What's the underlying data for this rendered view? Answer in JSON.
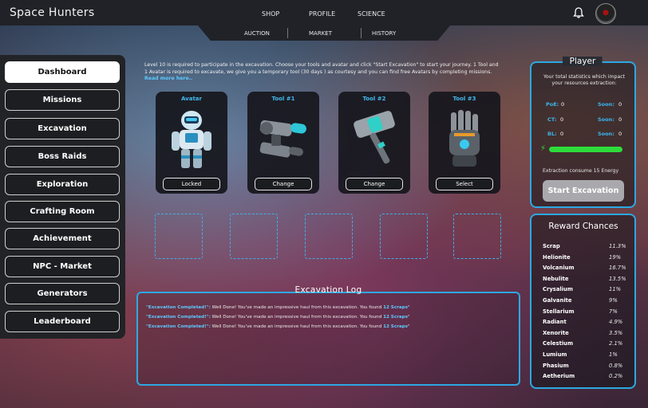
{
  "brand": "Space Hunters",
  "top_nav": [
    "SHOP",
    "PROFILE",
    "SCIENCE"
  ],
  "sub_nav": [
    "AUCTION",
    "MARKET",
    "HISTORY"
  ],
  "sidebar": [
    "Dashboard",
    "Missions",
    "Excavation",
    "Boss Raids",
    "Exploration",
    "Crafting Room",
    "Achievement",
    "NPC - Market",
    "Generators",
    "Leaderboard"
  ],
  "intro": {
    "text": "Level 10 is required to participate in the excavation. Choose your tools and avatar and click \"Start Excavation\" to start your journey. 1 Tool and 1 Avatar is required to excavate, we give you a temporary tool (30 days ) as courtesy and  you can  find free Avatars by completing missions. ",
    "more": "Read more here.."
  },
  "cards": [
    {
      "title": "Avatar",
      "button": "Locked",
      "icon": "robot-avatar-icon"
    },
    {
      "title": "Tool #1",
      "button": "Change",
      "icon": "plasma-drill-icon"
    },
    {
      "title": "Tool #2",
      "button": "Change",
      "icon": "hammer-icon"
    },
    {
      "title": "Tool #3",
      "button": "Select",
      "icon": "power-glove-icon"
    }
  ],
  "log": {
    "title": "Excavation Log",
    "entries": [
      {
        "status": "\"Excavation Completed!\":",
        "msg": " Well Done! You've made an impressive haul from this excavation. You found ",
        "found": "12 Scraps",
        "end": "\""
      },
      {
        "status": "\"Excavation Completed!\":",
        "msg": " Well Done! You've made an impressive haul from this excavation. You found ",
        "found": "12 Scraps",
        "end": "\""
      },
      {
        "status": "\"Excavation Completed!\":",
        "msg": " Well Done! You've made an impressive haul from this excavation. You found ",
        "found": "12 Scraps",
        "end": "\""
      }
    ]
  },
  "player": {
    "title": "Player",
    "desc": "Your total statistics which impact your resources extraction:",
    "stats": [
      {
        "label": "PoE:",
        "value": "0",
        "soon_label": "Soon:",
        "soon_value": "0"
      },
      {
        "label": "CT:",
        "value": "0",
        "soon_label": "Soon:",
        "soon_value": "0"
      },
      {
        "label": "BL:",
        "value": "0",
        "soon_label": "Soon:",
        "soon_value": "0"
      }
    ],
    "energy_fraction": 1.0,
    "consume": "Extraction consume 15  Energy",
    "start_label": "Start Excavation"
  },
  "rewards": {
    "title": "Reward Chances",
    "items": [
      {
        "name": "Scrap",
        "pct": "11.3%"
      },
      {
        "name": "Helionite",
        "pct": "19%"
      },
      {
        "name": "Volcanium",
        "pct": "16.7%"
      },
      {
        "name": "Nebulite",
        "pct": "13.5%"
      },
      {
        "name": "Crysalium",
        "pct": "11%"
      },
      {
        "name": "Galvanite",
        "pct": "9%"
      },
      {
        "name": "Stellarium",
        "pct": "7%"
      },
      {
        "name": "Radiant",
        "pct": "4.9%"
      },
      {
        "name": "Xenorite",
        "pct": "3.5%"
      },
      {
        "name": "Celestium",
        "pct": "2.1%"
      },
      {
        "name": "Lumium",
        "pct": "1%"
      },
      {
        "name": "Phasium",
        "pct": "0.8%"
      },
      {
        "name": "Aetherium",
        "pct": "0.2%"
      }
    ]
  },
  "colors": {
    "accent": "#2da8e3",
    "energy": "#2ddc3a",
    "highlight": "#5ec8ff"
  }
}
